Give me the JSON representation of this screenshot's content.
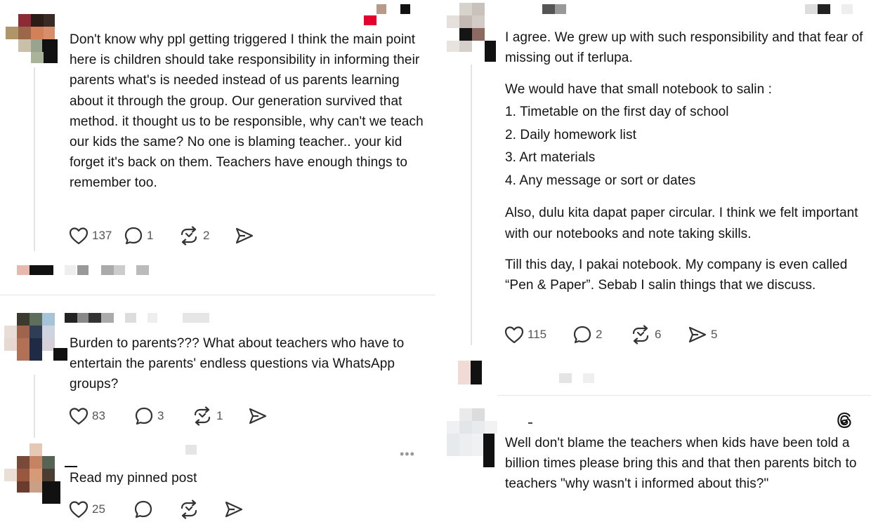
{
  "left_panel": {
    "post1": {
      "text": "Don't know why ppl getting triggered I think the main point here is children should take responsibility in informing their parents what's is needed instead of us parents learning about it through the group. Our generation survived that method. it thought us to be responsible, why can't we teach our kids the same? No one is blaming teacher.. your kid forget it's back on them. Teachers have enough things to remember too.",
      "likes": "137",
      "replies": "1",
      "reposts": "2"
    },
    "post2": {
      "text": "Burden to parents??? What about teachers who have to entertain the parents' endless questions via WhatsApp groups?",
      "likes": "83",
      "replies": "3",
      "reposts": "1"
    },
    "post3": {
      "text": "Read my pinned post",
      "likes": "25",
      "more": "•••"
    }
  },
  "right_panel": {
    "post1": {
      "intro": "I agree. We grew up with such responsibility and that fear of missing out if terlupa.",
      "list_intro": "We would have that small notebook to salin :",
      "list": [
        "1. Timetable on the first day of school",
        "2. Daily homework list",
        "3. Art materials",
        "4. Any message or sort or dates"
      ],
      "para2": "Also, dulu kita dapat paper circular. I think we felt important with our notebooks and note taking skills.",
      "para3": "Till this day, I pakai notebook. My company is even called “Pen & Paper”. Sebab I salin things that we discuss.",
      "likes": "115",
      "replies": "2",
      "reposts": "6",
      "shares": "5"
    },
    "post2": {
      "text": "Well don't blame the teachers when kids have been told a billion times please bring this and that then parents bitch to teachers \"why wasn't i informed about this?\""
    }
  },
  "icons": {
    "like": "heart-icon",
    "reply": "comment-bubble-icon",
    "repost": "repost-icon",
    "share": "send-icon",
    "brand": "threads-logo-icon"
  },
  "colors": {
    "text": "#141414",
    "icon": "#333333",
    "count": "#555555",
    "divider": "#e6e6e6"
  }
}
